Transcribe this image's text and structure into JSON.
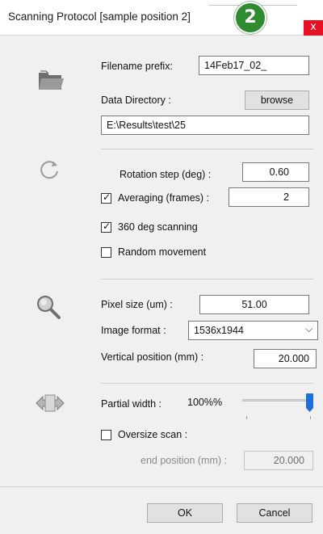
{
  "window": {
    "title": "Scanning Protocol [sample position 2]",
    "badge": "2",
    "close_glyph": "x"
  },
  "file_section": {
    "icon": "folder-open-icon",
    "filename_prefix_label": "Filename prefix:",
    "filename_prefix_value": "14Feb17_02_",
    "data_directory_label": "Data Directory :",
    "browse_label": "browse",
    "data_directory_value": "E:\\Results\\test\\25"
  },
  "rotation_section": {
    "icon": "rotate-icon",
    "rotation_step_label": "Rotation step (deg) :",
    "rotation_step_value": "0.60",
    "averaging_label": "Averaging (frames) :",
    "averaging_checked": true,
    "averaging_value": "2",
    "scan360_label": "360 deg scanning",
    "scan360_checked": true,
    "random_movement_label": "Random movement",
    "random_movement_checked": false
  },
  "image_section": {
    "icon": "magnifier-icon",
    "pixel_size_label": "Pixel size (um) :",
    "pixel_size_value": "51.00",
    "image_format_label": "Image format :",
    "image_format_value": "1536x1944",
    "vertical_position_label": "Vertical position (mm) :",
    "vertical_position_value": "20.000"
  },
  "width_section": {
    "icon": "horizontal-arrows-icon",
    "partial_width_label": "Partial width :",
    "partial_width_value": "100%%",
    "partial_width_level": 1.0,
    "oversize_scan_label": "Oversize scan :",
    "oversize_scan_checked": false,
    "end_position_label": "end position (mm) :",
    "end_position_value": "20.000"
  },
  "footer": {
    "ok_label": "OK",
    "cancel_label": "Cancel"
  },
  "colors": {
    "badge": "#2f8b2f",
    "close": "#e81123",
    "slider_thumb": "#1e6fd9"
  }
}
